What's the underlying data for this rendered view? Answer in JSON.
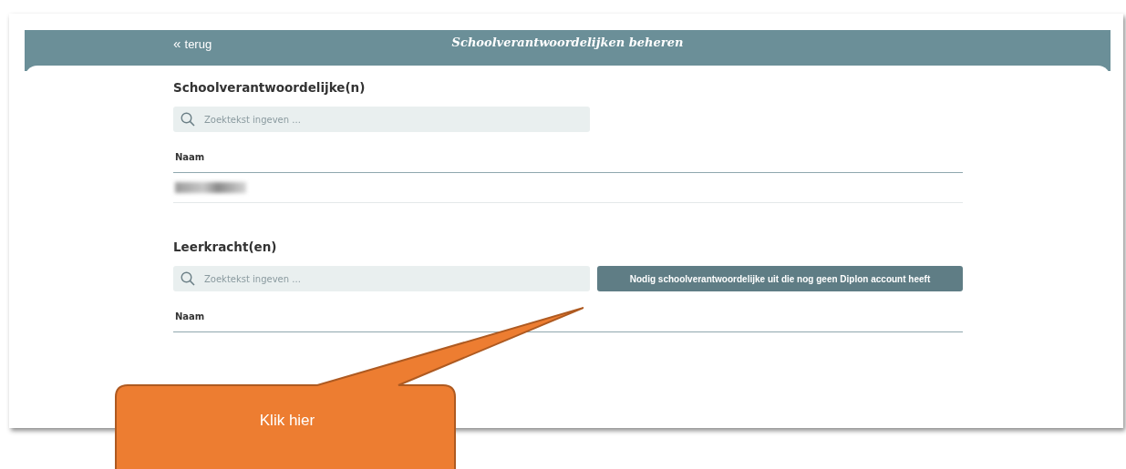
{
  "header": {
    "back_icon": "«",
    "back_link": "terug",
    "title": "Schoolverantwoordelijken beheren"
  },
  "sections": [
    {
      "heading": "Schoolverantwoordelijke(n)",
      "search": {
        "placeholder": "Zoektekst ingeven ..."
      },
      "table": {
        "columns": [
          "Naam"
        ],
        "rows": [
          {
            "kind": "redacted"
          }
        ]
      }
    },
    {
      "heading": "Leerkracht(en)",
      "search": {
        "placeholder": "Zoektekst ingeven ..."
      },
      "button": "Nodig schoolverantwoordelijke uit die nog geen Diplon account heeft",
      "table": {
        "columns": [
          "Naam"
        ]
      }
    }
  ],
  "callout": {
    "text": "Klik hier"
  }
}
